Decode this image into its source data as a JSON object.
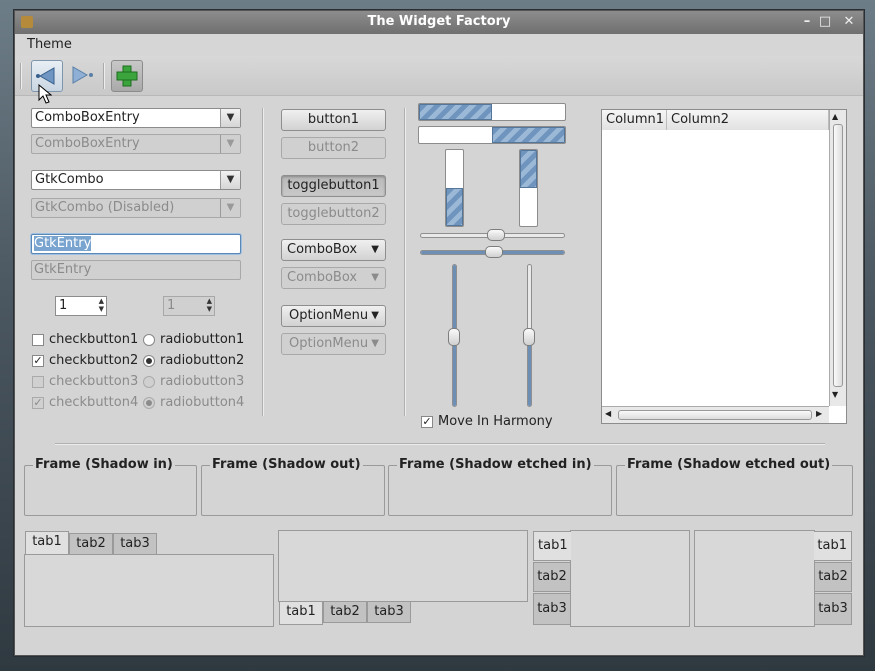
{
  "window": {
    "title": "The Widget Factory",
    "controls": {
      "minimize": "–",
      "maximize": "□",
      "close": "✕"
    }
  },
  "menu": {
    "theme": "Theme"
  },
  "toolbar": {
    "back_icon": "arrow-left-icon",
    "forward_icon": "arrow-right-icon",
    "add_icon": "plus-icon"
  },
  "left": {
    "combo_entry": "ComboBoxEntry",
    "combo_entry_dis": "ComboBoxEntry",
    "gtk_combo": "GtkCombo",
    "gtk_combo_dis": "GtkCombo (Disabled)",
    "entry": "GtkEntry",
    "entry_dis": "GtkEntry",
    "spin": "1",
    "spin_dis": "1",
    "checks": [
      {
        "label": "checkbutton1",
        "checked": false
      },
      {
        "label": "checkbutton2",
        "checked": true
      },
      {
        "label": "checkbutton3",
        "checked": false
      },
      {
        "label": "checkbutton4",
        "checked": true
      }
    ],
    "radios": [
      {
        "label": "radiobutton1",
        "on": false
      },
      {
        "label": "radiobutton2",
        "on": true
      },
      {
        "label": "radiobutton3",
        "on": false
      },
      {
        "label": "radiobutton4",
        "on": true
      }
    ]
  },
  "middle": {
    "button1": "button1",
    "button2": "button2",
    "toggle1": "togglebutton1",
    "toggle2": "togglebutton2",
    "combobox": "ComboBox",
    "combobox_dis": "ComboBox",
    "option": "OptionMenu",
    "option_dis": "OptionMenu"
  },
  "sliders": {
    "progress_h": [
      0.5,
      0.5
    ],
    "progress_v": [
      0.5,
      0.5
    ],
    "scale_h": [
      0.52,
      0.5
    ],
    "scale_v": [
      0.5,
      0.5
    ],
    "harmony": "Move In Harmony",
    "harmony_checked": true
  },
  "tree": {
    "columns": [
      "Column1",
      "Column2"
    ]
  },
  "frames": [
    "Frame (Shadow in)",
    "Frame (Shadow out)",
    "Frame (Shadow etched in)",
    "Frame (Shadow etched out)"
  ],
  "tabs": [
    "tab1",
    "tab2",
    "tab3"
  ]
}
